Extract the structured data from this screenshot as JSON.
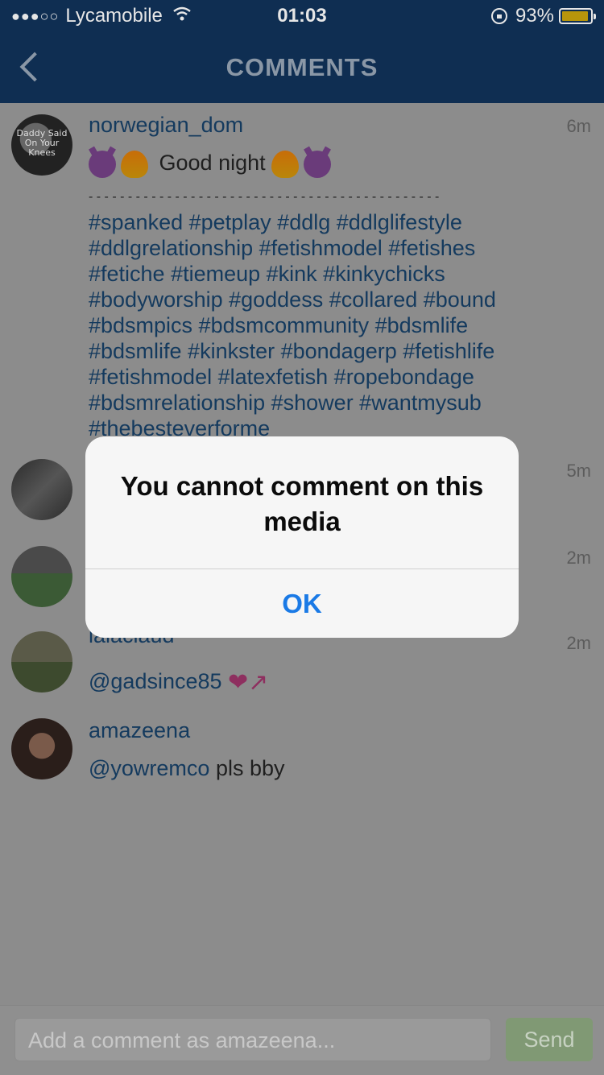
{
  "status_bar": {
    "signal": "●●●○○",
    "carrier": "Lycamobile",
    "time": "01:03",
    "battery": "93%",
    "battery_level": 0.93
  },
  "nav": {
    "title": "COMMENTS"
  },
  "comments": [
    {
      "username": "norwegian_dom",
      "time": "6m",
      "avatar_text": "Daddy Said On Your Knees",
      "greeting": "Good night",
      "separator": "- - - - - - - - - - - - - - - - - - - - - - - - - - - - - - - - - - - - - - - - - - - - -",
      "hashtags": "#spanked #petplay #ddlg #ddlglifestyle #ddlgrelationship #fetishmodel #fetishes #fetiche #tiemeup #kink #kinkychicks #bodyworship #goddess #collared #bound #bdsmpics #bdsmcommunity #bdsmlife #bdsmlife #kinkster #bondagerp #fetishlife #fetishmodel #latexfetish #ropebondage #bdsmrelationship #shower #wantmysub #thebesteverforme"
    },
    {
      "time": "5m"
    },
    {
      "time": "2m"
    },
    {
      "username": "lalaclaud",
      "time": "2m",
      "mention": "@gadsince85"
    },
    {
      "username": "amazeena",
      "mention": "@yowremco",
      "text": "pls bby"
    }
  ],
  "alert": {
    "message": "You cannot comment on this media",
    "ok_label": "OK"
  },
  "composer": {
    "placeholder": "Add a comment as amazeena...",
    "send_label": "Send"
  }
}
